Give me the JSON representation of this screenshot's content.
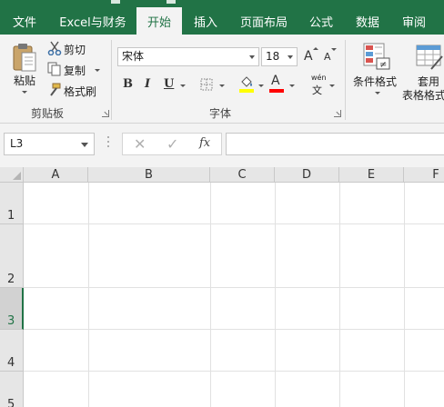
{
  "tabs": [
    {
      "label": "文件",
      "active": false
    },
    {
      "label": "Excel与财务",
      "active": false
    },
    {
      "label": "开始",
      "active": true
    },
    {
      "label": "插入",
      "active": false
    },
    {
      "label": "页面布局",
      "active": false
    },
    {
      "label": "公式",
      "active": false
    },
    {
      "label": "数据",
      "active": false
    },
    {
      "label": "审阅",
      "active": false
    }
  ],
  "clipboard": {
    "paste_label": "粘贴",
    "cut_label": "剪切",
    "copy_label": "复制",
    "format_painter_label": "格式刷",
    "group_label": "剪贴板"
  },
  "font": {
    "font_name": "宋体",
    "font_size": "18",
    "increase_label": "A",
    "decrease_label": "A",
    "bold_label": "B",
    "italic_label": "I",
    "underline_label": "U",
    "phonetic_top": "wén",
    "phonetic_bottom": "文",
    "font_color_label": "A",
    "group_label": "字体",
    "fill_color": "#ffff00",
    "font_color": "#ff0000"
  },
  "styles": {
    "conditional_label": "条件格式",
    "table_label_1": "套用",
    "table_label_2": "表格格式"
  },
  "formula_bar": {
    "name_box": "L3",
    "cancel_symbol": "✕",
    "enter_symbol": "✓",
    "fx_label": "fx",
    "formula": ""
  },
  "sheet": {
    "columns": [
      "A",
      "B",
      "C",
      "D",
      "E",
      "F"
    ],
    "rows": [
      "1",
      "2",
      "3",
      "4",
      "5"
    ],
    "selected_row": "3"
  },
  "colors": {
    "accent": "#217346",
    "ribbon_bg": "#f3f3f3",
    "header_bg": "#e6e6e6"
  }
}
